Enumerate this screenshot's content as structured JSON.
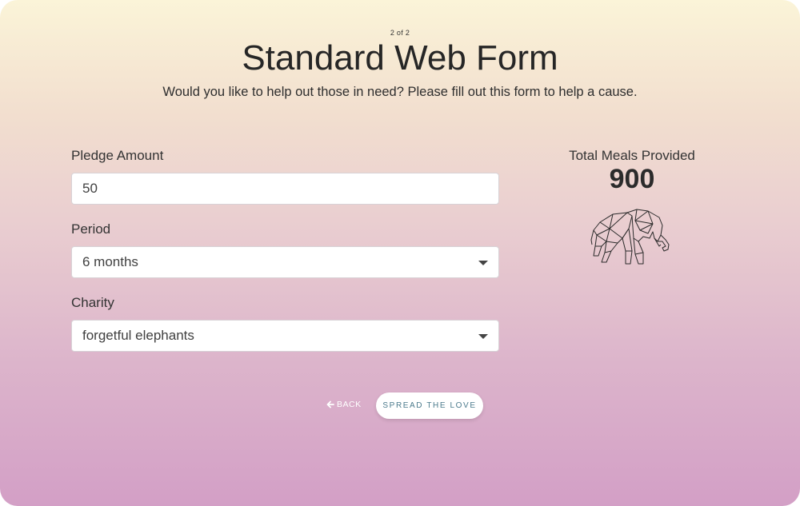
{
  "header": {
    "step": "2 of 2",
    "title": "Standard Web Form",
    "subtitle": "Would you like to help out those in need? Please fill out this form to help a cause."
  },
  "form": {
    "pledge": {
      "label": "Pledge Amount",
      "value": "50"
    },
    "period": {
      "label": "Period",
      "value": "6 months"
    },
    "charity": {
      "label": "Charity",
      "value": "forgetful elephants"
    }
  },
  "stats": {
    "label": "Total Meals Provided",
    "value": "900",
    "icon": "elephant-icon"
  },
  "actions": {
    "back_label": "BACK",
    "back_icon": "arrow-left-icon",
    "submit_label": "SPREAD THE LOVE"
  }
}
